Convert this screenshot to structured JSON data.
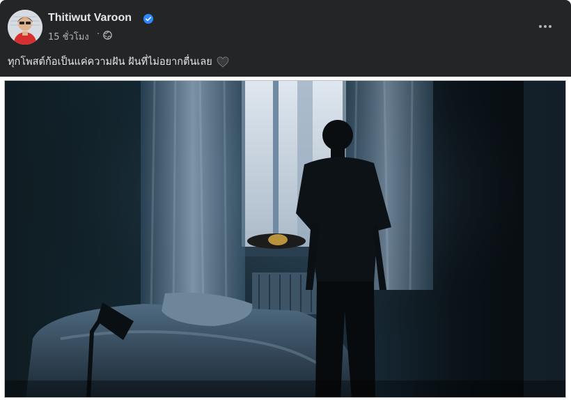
{
  "post": {
    "author": "Thitiwut Varoon",
    "time": "15 ชั่วโมง",
    "separator": "·",
    "privacy_icon": "globe-icon",
    "verified_icon": "verified-badge-icon",
    "more_icon": "more-options-icon",
    "text": "ทุกโพสต์ก้อเป็นแค่ความฝัน ฝันที่ไม่อยากตื่นเลย",
    "emoji_icon": "black-heart-icon"
  },
  "colors": {
    "header_bg": "#242526",
    "name": "#e4e6eb",
    "meta": "#b0b3b8",
    "verified": "#2d88ff"
  }
}
